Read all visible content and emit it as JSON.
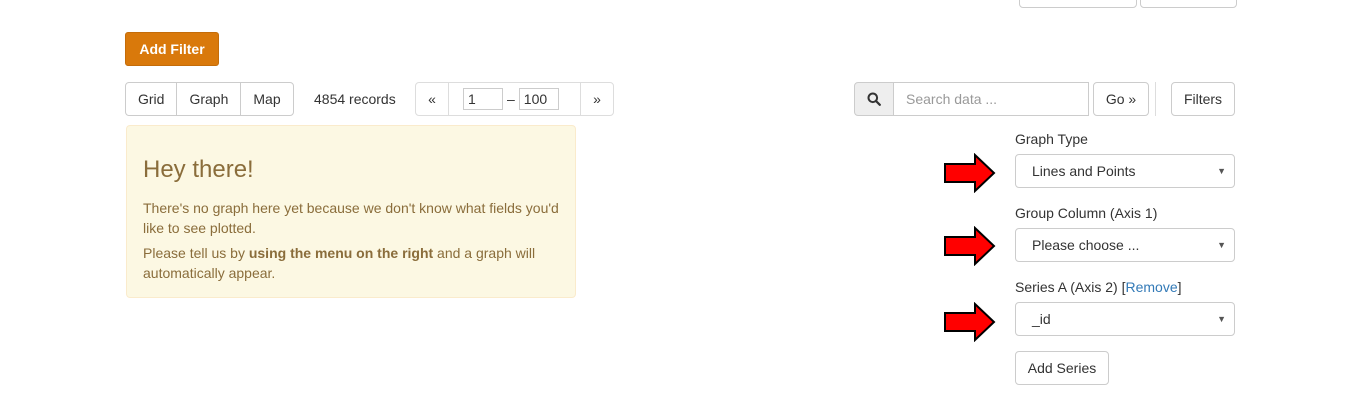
{
  "toolbar": {
    "add_filter_label": "Add Filter",
    "views": [
      "Grid",
      "Graph",
      "Map"
    ],
    "records_text": "4854 records",
    "pager": {
      "prev": "«",
      "next": "»",
      "from": "1",
      "dash": "–",
      "to": "100"
    },
    "search": {
      "placeholder": "Search data ...",
      "go_label": "Go »"
    },
    "filters_label": "Filters"
  },
  "alert": {
    "heading": "Hey there!",
    "line1": "There's no graph here yet because we don't know what fields you'd like to see plotted.",
    "line2_prefix": "Please tell us by ",
    "line2_bold": "using the menu on the right",
    "line2_suffix": " and a graph will automatically appear."
  },
  "graph_menu": {
    "graph_type_label": "Graph Type",
    "graph_type_value": "Lines and Points",
    "group_column_label": "Group Column (Axis 1)",
    "group_column_value": "Please choose ...",
    "series_a_label": "Series A (Axis 2) ",
    "series_a_bracket_open": "[",
    "series_a_remove": "Remove",
    "series_a_bracket_close": "]",
    "series_a_value": "_id",
    "add_series_label": "Add Series"
  },
  "icons": {
    "search": "search-icon",
    "caret": "caret-down-icon",
    "arrow": "red-arrow-icon"
  },
  "colors": {
    "accent": "#d9790b",
    "alert_bg": "#fcf8e3",
    "alert_text": "#8a6d3b",
    "link": "#337ab7",
    "arrow_fill": "#ff0000"
  }
}
